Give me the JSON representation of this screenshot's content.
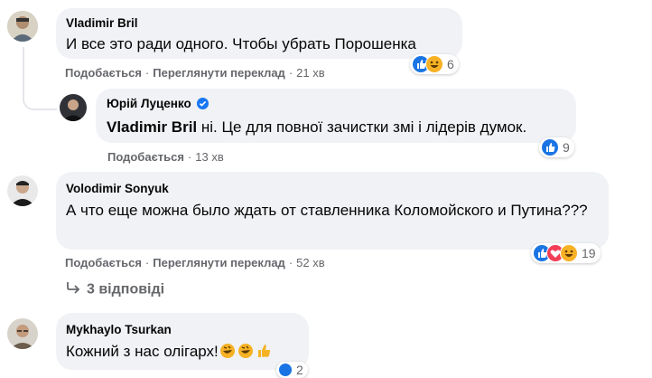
{
  "comments": [
    {
      "author": "Vladimir Bril",
      "text": "И все это ради одного. Чтобы убрать Порошенка",
      "actions": {
        "like": "Подобається",
        "translate": "Переглянути переклад",
        "time": "21 хв"
      },
      "reactions": {
        "icons": [
          "like-icon",
          "haha-icon"
        ],
        "count": "6"
      }
    },
    {
      "author": "Юрій Луценко",
      "verified": true,
      "mention": "Vladimir Bril",
      "text": " ні. Це для повної зачистки змі і лідерів думок.",
      "actions": {
        "like": "Подобається",
        "time": "13 хв"
      },
      "reactions": {
        "icons": [
          "like-icon"
        ],
        "count": "9"
      }
    },
    {
      "author": "Volodimir Sonyuk",
      "text": "А что еще можна было ждать от ставленника Коломойского и Путина???",
      "actions": {
        "like": "Подобається",
        "translate": "Переглянути переклад",
        "time": "52 хв"
      },
      "reactions": {
        "icons": [
          "like-icon",
          "love-icon",
          "haha-icon"
        ],
        "count": "19"
      }
    },
    {
      "author": "Mykhaylo Tsurkan",
      "text": "Кожний з нас олігарх!",
      "emojis": [
        "rofl-emoji",
        "rofl-emoji",
        "thumbs-up-emoji"
      ],
      "reactions": {
        "count": "2"
      }
    }
  ],
  "replies_link": "3 відповіді",
  "separator": "·",
  "colors": {
    "bubble": "#f0f2f5",
    "meta": "#65676b",
    "like": "#1b74e4",
    "haha": "#f7b125",
    "love": "#f33e58",
    "verified": "#1877f2"
  }
}
